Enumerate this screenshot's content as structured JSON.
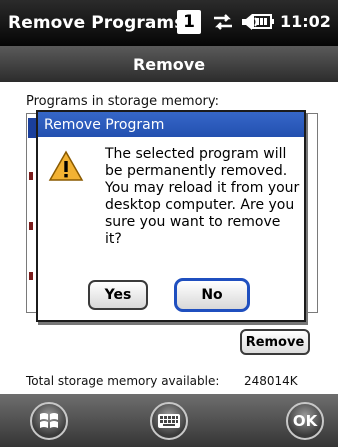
{
  "status_bar": {
    "title": "Remove Programs",
    "badge": "1",
    "time": "11:02",
    "icons": [
      "connectivity-icon",
      "speaker-icon",
      "battery-icon"
    ]
  },
  "header": {
    "title": "Remove"
  },
  "main": {
    "programs_label": "Programs in storage memory:",
    "remove_label": "Remove",
    "storage_label": "Total storage memory available:",
    "storage_value": "248014K"
  },
  "dialog": {
    "title": "Remove Program",
    "icon": "warning-icon",
    "message": "The selected program will be permanently removed. You may reload it from your desktop computer. Are you sure you want to remove it?",
    "yes_label": "Yes",
    "no_label": "No"
  },
  "bottom_bar": {
    "left_icon": "windows-start-icon",
    "center_icon": "keyboard-icon",
    "ok_label": "OK"
  },
  "colors": {
    "dialog_title": "#2d5bbd",
    "focus_ring": "#1f4fbf",
    "list_selection": "#1a3f9c"
  }
}
